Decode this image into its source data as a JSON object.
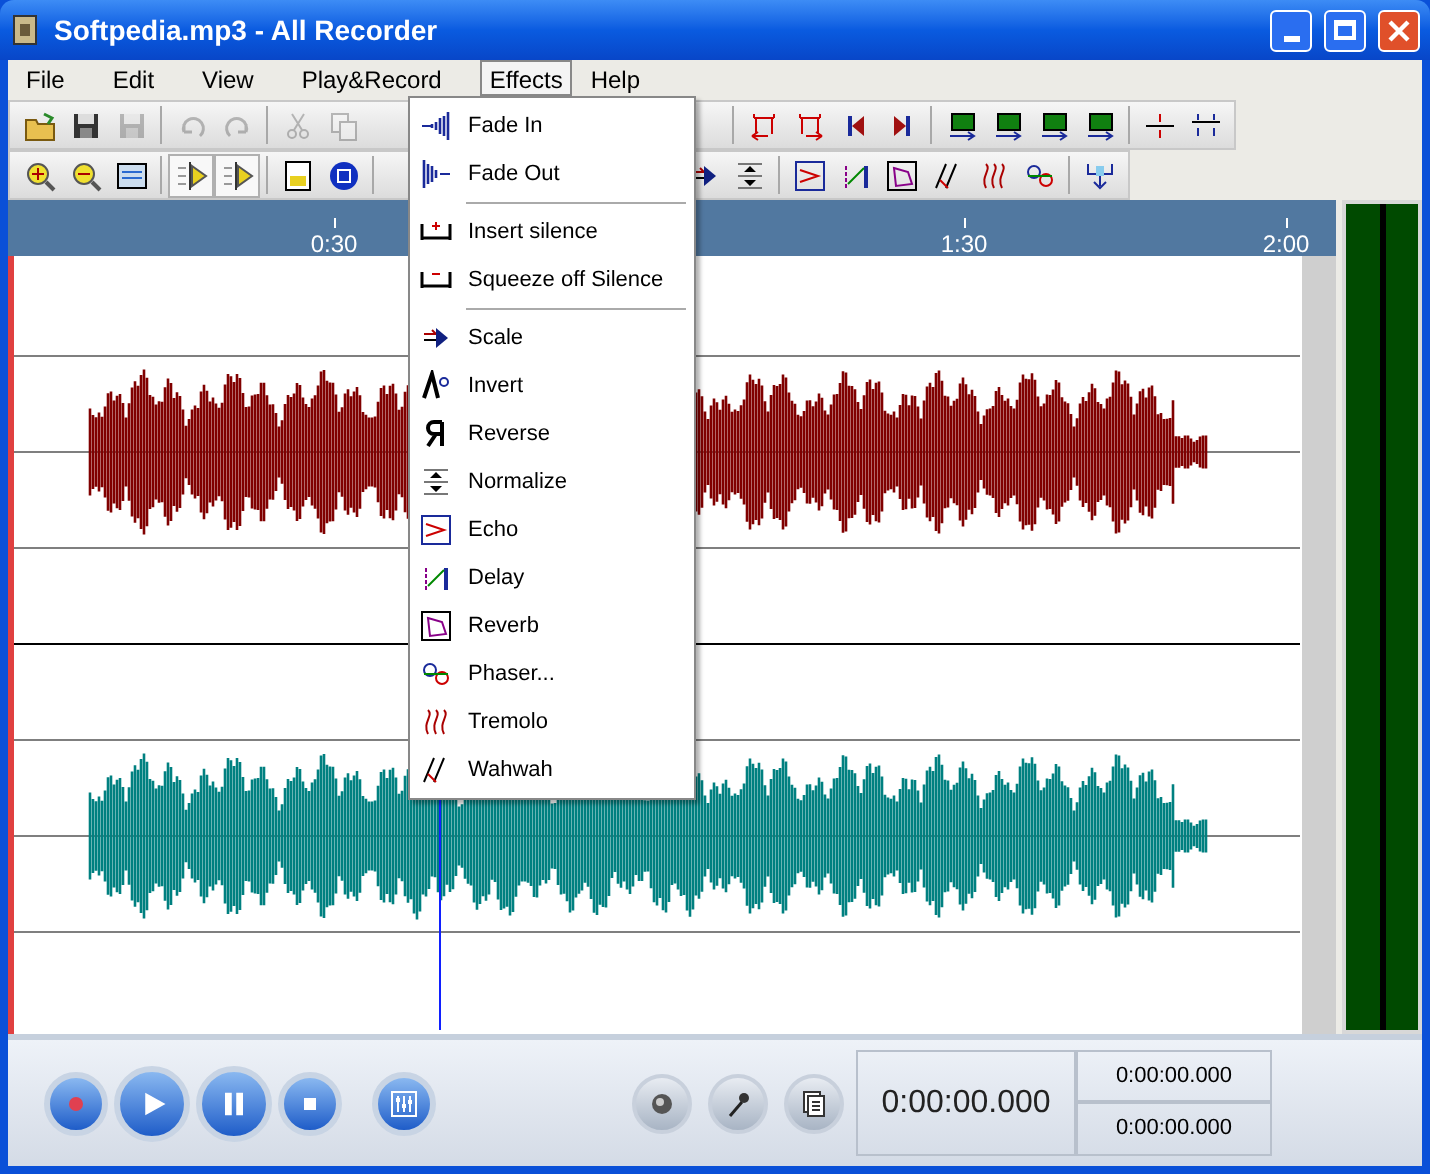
{
  "window": {
    "title": "Softpedia.mp3 - All Recorder"
  },
  "menu": [
    {
      "label": "File",
      "selected": false
    },
    {
      "label": "Edit",
      "selected": false
    },
    {
      "label": "View",
      "selected": false
    },
    {
      "label": "Play&Record",
      "selected": false
    },
    {
      "label": "Effects",
      "selected": true
    },
    {
      "label": "Help",
      "selected": false
    }
  ],
  "toolbar_1": [
    {
      "kind": "open",
      "disabled": false
    },
    {
      "kind": "save",
      "disabled": false
    },
    {
      "kind": "save",
      "disabled": true
    },
    {
      "kind": "sep"
    },
    {
      "kind": "undo",
      "disabled": true
    },
    {
      "kind": "redo",
      "disabled": true
    },
    {
      "kind": "sep"
    },
    {
      "kind": "cut",
      "disabled": true
    },
    {
      "kind": "copy",
      "disabled": true
    },
    {
      "kind": "gap"
    },
    {
      "kind": "sep"
    },
    {
      "kind": "bracket-left",
      "disabled": false
    },
    {
      "kind": "bracket-right",
      "disabled": false
    },
    {
      "kind": "skip-start",
      "disabled": false
    },
    {
      "kind": "skip-end",
      "disabled": false
    },
    {
      "kind": "sep"
    },
    {
      "kind": "green",
      "disabled": false
    },
    {
      "kind": "green",
      "disabled": false
    },
    {
      "kind": "green",
      "disabled": false
    },
    {
      "kind": "green",
      "disabled": false
    },
    {
      "kind": "sep"
    },
    {
      "kind": "split",
      "disabled": false
    },
    {
      "kind": "join",
      "disabled": false
    }
  ],
  "toolbar_2": [
    {
      "kind": "zoom-in",
      "disabled": false
    },
    {
      "kind": "zoom-out",
      "disabled": false
    },
    {
      "kind": "fit",
      "disabled": false
    },
    {
      "kind": "sep"
    },
    {
      "kind": "toggle",
      "disabled": false
    },
    {
      "kind": "toggle",
      "disabled": false
    },
    {
      "kind": "sep"
    },
    {
      "kind": "disk",
      "disabled": false
    },
    {
      "kind": "loop",
      "disabled": false
    },
    {
      "kind": "sep"
    },
    {
      "kind": "gap2"
    },
    {
      "kind": "scale",
      "disabled": false
    },
    {
      "kind": "normalize",
      "disabled": false
    },
    {
      "kind": "sep"
    },
    {
      "kind": "echo",
      "disabled": false
    },
    {
      "kind": "delay",
      "disabled": false
    },
    {
      "kind": "reverb",
      "disabled": false
    },
    {
      "kind": "wahwah",
      "disabled": false
    },
    {
      "kind": "tremolo",
      "disabled": false
    },
    {
      "kind": "phaser",
      "disabled": false
    },
    {
      "kind": "sep"
    },
    {
      "kind": "tool",
      "disabled": false
    }
  ],
  "effects_menu": {
    "groups": [
      [
        {
          "label": "Fade In",
          "kind": "fade-in"
        },
        {
          "label": "Fade Out",
          "kind": "fade-out"
        }
      ],
      [
        {
          "label": "Insert silence",
          "kind": "insert"
        },
        {
          "label": "Squeeze off Silence",
          "kind": "squeeze"
        }
      ],
      [
        {
          "label": "Scale",
          "kind": "scale"
        },
        {
          "label": "Invert",
          "kind": "invert"
        },
        {
          "label": "Reverse",
          "kind": "reverse"
        },
        {
          "label": "Normalize",
          "kind": "normalize"
        },
        {
          "label": "Echo",
          "kind": "echo"
        },
        {
          "label": "Delay",
          "kind": "delay"
        },
        {
          "label": "Reverb",
          "kind": "reverb"
        },
        {
          "label": "Phaser...",
          "kind": "phaser"
        },
        {
          "label": "Tremolo",
          "kind": "tremolo"
        },
        {
          "label": "Wahwah",
          "kind": "wahwah"
        }
      ]
    ]
  },
  "ruler": [
    "0:30",
    "1:30",
    "2:00"
  ],
  "transport": [
    {
      "kind": "record"
    },
    {
      "kind": "play"
    },
    {
      "kind": "pause"
    },
    {
      "kind": "stop"
    },
    {
      "kind": "mixer"
    }
  ],
  "devices": [
    {
      "kind": "speaker"
    },
    {
      "kind": "microphone"
    },
    {
      "kind": "document"
    }
  ],
  "time_display": {
    "main": "0:00:00.000",
    "start": "0:00:00.000",
    "end": "0:00:00.000"
  }
}
